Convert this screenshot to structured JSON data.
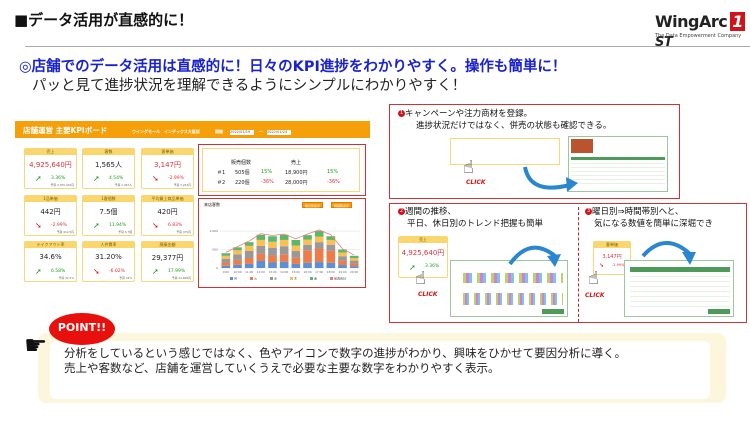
{
  "slide": {
    "title": "■データ活用が直感的に！",
    "logo": {
      "name": "WingArc",
      "mark": "1",
      "suffix": "ST",
      "tagline": "The Data Empowerment Company"
    },
    "lead_heading": "◎店舗でのデータ活用は直感的に！日々のKPI進捗をわかりやすく。操作も簡単に！",
    "lead_sub": "パッと見て進捗状況を理解できるようにシンプルにわかりやすく！"
  },
  "dashboard": {
    "title": "店舗運営 主要KPIボード",
    "store": "ウイングモール　インデックス大阪店",
    "period_label": "期間",
    "date_from": "2022/01/19",
    "date_sep": "～",
    "date_to": "2022/01/24",
    "cards": [
      {
        "label": "売上",
        "value": "4,925,640円",
        "trend": "up",
        "pct": "3.36%",
        "foot": "予算 4,765,410円",
        "red": true
      },
      {
        "label": "客数",
        "value": "1,565人",
        "trend": "up",
        "pct": "4.54%",
        "foot": "予算 1,497人",
        "red": false
      },
      {
        "label": "客単価",
        "value": "3,147円",
        "trend": "down",
        "pct": "-2.99%",
        "foot": "予算 3,243円",
        "red": true
      },
      {
        "label": "1品単価",
        "value": "442円",
        "trend": "down",
        "pct": "-2.99%",
        "foot": "予算 412.5円",
        "red": false
      },
      {
        "label": "1客個数",
        "value": "7.5個",
        "trend": "up",
        "pct": "11.94%",
        "foot": "予算 6.7個",
        "red": false
      },
      {
        "label": "平均買上商品単価",
        "value": "420円",
        "trend": "down",
        "pct": "6.83%",
        "foot": "予算 475円",
        "red": false
      },
      {
        "label": "テイクアウト率",
        "value": "34.6%",
        "trend": "up",
        "pct": "6.58%",
        "foot": "予算 32.2%",
        "red": false
      },
      {
        "label": "人件費率",
        "value": "31.20%",
        "trend": "down",
        "pct": "-6.02%",
        "foot": "予算 33%",
        "red": false
      },
      {
        "label": "廃棄金額",
        "value": "29,377円",
        "trend": "up",
        "pct": "17.99%",
        "foot": "予算 24,899円",
        "red": false
      }
    ],
    "ranking": {
      "col1": "販売個数",
      "col2": "売上",
      "rows": [
        {
          "rank": "＃1",
          "qty": "505個",
          "qty_pct": "15%",
          "sales": "18,900円",
          "sales_pct": "15%",
          "pos": true
        },
        {
          "rank": "＃2",
          "qty": "220個",
          "qty_pct": "-36%",
          "sales": "28,000円",
          "sales_pct": "-36%",
          "pos": false
        }
      ]
    },
    "chart_panel": {
      "title": "来店客数",
      "btn1": "曜日別表示",
      "btn2": "時間別表示"
    }
  },
  "chart_data": {
    "type": "bar",
    "stacked": true,
    "title": "来店客数",
    "categories": [
      "9:00",
      "10:00",
      "11:00",
      "12:00",
      "13:00",
      "14:00",
      "15:00",
      "16:00",
      "17:00",
      "18:00",
      "19:00",
      "20:00"
    ],
    "series": [
      {
        "name": "月",
        "color": "#5b8fd6",
        "values": [
          60,
          90,
          110,
          190,
          150,
          170,
          110,
          140,
          160,
          140,
          80,
          50
        ]
      },
      {
        "name": "火",
        "color": "#ec7c4a",
        "values": [
          90,
          130,
          160,
          200,
          190,
          200,
          170,
          340,
          370,
          330,
          120,
          70
        ]
      },
      {
        "name": "水",
        "color": "#999999",
        "values": [
          100,
          150,
          190,
          210,
          210,
          220,
          180,
          150,
          170,
          160,
          120,
          80
        ]
      },
      {
        "name": "木",
        "color": "#fbbf52",
        "values": [
          80,
          110,
          140,
          160,
          160,
          170,
          150,
          140,
          150,
          130,
          100,
          70
        ]
      },
      {
        "name": "金",
        "color": "#5bb86a",
        "values": [
          70,
          80,
          100,
          140,
          150,
          140,
          150,
          120,
          150,
          100,
          80,
          60
        ]
      }
    ],
    "line": {
      "name": "前週合計",
      "color": "#f07a7a",
      "values": [
        420,
        580,
        730,
        930,
        880,
        920,
        790,
        920,
        1030,
        900,
        520,
        350
      ]
    },
    "yticks": [
      "0",
      "500",
      "1,000"
    ],
    "ylim": [
      0,
      1300
    ]
  },
  "panels": [
    {
      "num": "1",
      "line1": "キャンペーンや注力商材を登録。",
      "line2": "進捗状況だけではなく、併売の状態も確認できる。",
      "click": "CLICK"
    },
    {
      "num": "2",
      "line1": "週間の推移、",
      "line2": "平日、休日別のトレンド把握も簡単",
      "click": "CLICK",
      "card_label": "売上",
      "card_value": "4,925,640円",
      "card_pct": "3.36%"
    },
    {
      "num": "3",
      "line1": "曜日別⇒時間帯別へと、",
      "line2": "気になる数値を簡単に深堀でき",
      "click": "CLICK",
      "card_label": "客単価",
      "card_value": "3,147円",
      "card_pct": "-2.99%"
    }
  ],
  "point": {
    "badge": "POINT!!",
    "line1": "分析をしているという感じではなく、色やアイコンで数字の進捗がわかり、興味をひかせて要因分析に導く。",
    "line2": "売上や客数など、店舗を運営していくうえで必要な主要な数字をわかりやすく表示。"
  }
}
